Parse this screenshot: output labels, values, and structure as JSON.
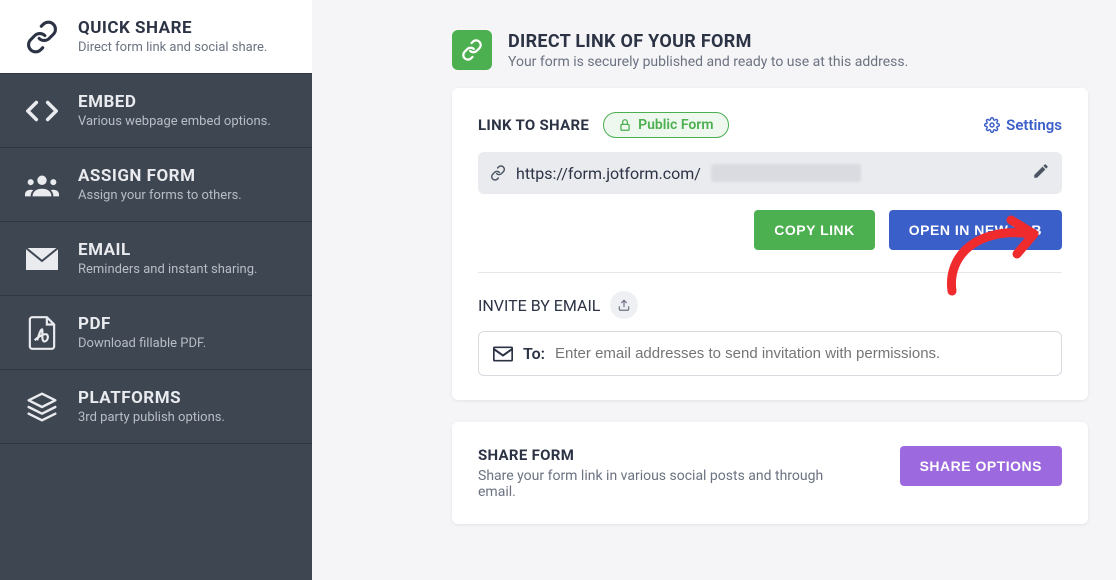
{
  "sidebar": {
    "items": [
      {
        "title": "QUICK SHARE",
        "desc": "Direct form link and social share."
      },
      {
        "title": "EMBED",
        "desc": "Various webpage embed options."
      },
      {
        "title": "ASSIGN FORM",
        "desc": "Assign your forms to others."
      },
      {
        "title": "EMAIL",
        "desc": "Reminders and instant sharing."
      },
      {
        "title": "PDF",
        "desc": "Download fillable PDF."
      },
      {
        "title": "PLATFORMS",
        "desc": "3rd party publish options."
      }
    ]
  },
  "header": {
    "title": "DIRECT LINK OF YOUR FORM",
    "sub": "Your form is securely published and ready to use at this address."
  },
  "linkShare": {
    "label": "LINK TO SHARE",
    "pill": "Public Form",
    "settings": "Settings",
    "url": "https://form.jotform.com/",
    "copy": "COPY LINK",
    "open": "OPEN IN NEW TAB"
  },
  "invite": {
    "label": "INVITE BY EMAIL",
    "to": "To:",
    "placeholder": "Enter email addresses to send invitation with permissions."
  },
  "share": {
    "title": "SHARE FORM",
    "desc": "Share your form link in various social posts and through email.",
    "btn": "SHARE OPTIONS"
  }
}
